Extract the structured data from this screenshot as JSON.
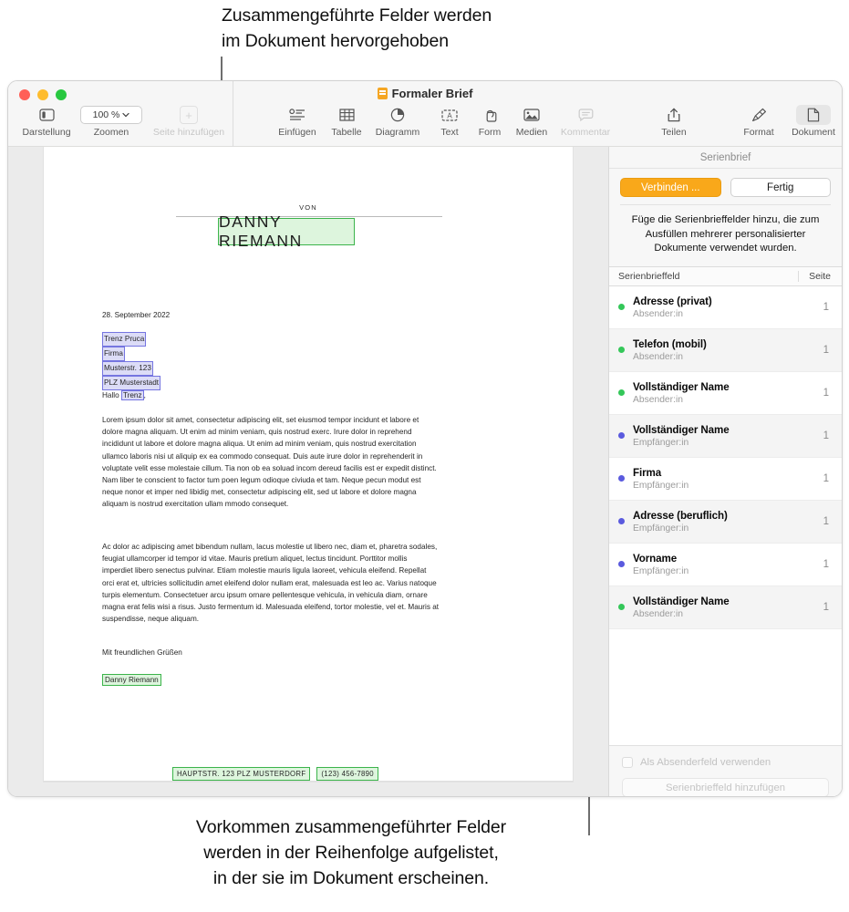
{
  "callouts": {
    "top": "Zusammengeführte Felder werden\nim Dokument hervorgehoben",
    "bottom": "Vorkommen zusammengeführter Felder\nwerden in der Reihenfolge aufgelistet,\nin der sie im Dokument erscheinen."
  },
  "window": {
    "title": "Formaler Brief"
  },
  "toolbar": {
    "view_label": "Darstellung",
    "zoom_label": "Zoomen",
    "zoom_value": "100 %",
    "add_page_label": "Seite hinzufügen",
    "insert_label": "Einfügen",
    "table_label": "Tabelle",
    "chart_label": "Diagramm",
    "text_label": "Text",
    "shape_label": "Form",
    "media_label": "Medien",
    "comment_label": "Kommentar",
    "share_label": "Teilen",
    "format_label": "Format",
    "document_label": "Dokument"
  },
  "document": {
    "letterhead_label": "VON",
    "letterhead_name": "DANNY RIEMANN",
    "date": "28. September 2022",
    "address": [
      "Trenz Pruca",
      "Firma",
      "Musterstr. 123",
      "PLZ Musterstadt"
    ],
    "salutation_prefix": "Hallo ",
    "salutation_field": "Trenz",
    "salutation_suffix": ",",
    "paragraph_1": "Lorem ipsum dolor sit amet, consectetur adipiscing elit, set eiusmod tempor incidunt et labore et dolore magna aliquam. Ut enim ad minim veniam, quis nostrud exerc. Irure dolor in reprehend incididunt ut labore et dolore magna aliqua. Ut enim ad minim veniam, quis nostrud exercitation ullamco laboris nisi ut aliquip ex ea commodo consequat. Duis aute irure dolor in reprehenderit in voluptate velit esse molestaie cillum. Tia non ob ea soluad incom dereud facilis est er expedit distinct. Nam liber te conscient to factor tum poen legum odioque civiuda et tam. Neque pecun modut est neque nonor et imper ned libidig met, consectetur adipiscing elit, sed ut labore et dolore magna aliquam is nostrud exercitation ullam mmodo consequet.",
    "paragraph_2": "Ac dolor ac adipiscing amet bibendum nullam, lacus molestie ut libero nec, diam et, pharetra sodales, feugiat ullamcorper id tempor id vitae. Mauris pretium aliquet, lectus tincidunt. Porttitor mollis imperdiet libero senectus pulvinar. Etiam molestie mauris ligula laoreet, vehicula eleifend. Repellat orci erat et, ultricies sollicitudin amet eleifend dolor nullam erat, malesuada est leo ac. Varius natoque turpis elementum. Consectetuer arcu ipsum ornare pellentesque vehicula, in vehicula diam, ornare magna erat felis wisi a risus. Justo fermentum id. Malesuada eleifend, tortor molestie, vel et. Mauris at suspendisse, neque aliquam.",
    "sign_off": "Mit freundlichen Grüßen",
    "signature_name": "Danny Riemann",
    "footer_address": "HAUPTSTR. 123     PLZ MUSTERDORF",
    "footer_phone": "(123) 456-7890"
  },
  "inspector": {
    "title": "Serienbrief",
    "merge_button": "Verbinden ...",
    "done_button": "Fertig",
    "description": "Füge die Serienbrieffelder hinzu, die zum Ausfüllen mehrerer personalisierter Dokumente verwendet wurden.",
    "column_field": "Serienbrieffeld",
    "column_page": "Seite",
    "sender_checkbox_label": "Als Absenderfeld verwenden",
    "add_field_button": "Serienbrieffeld hinzufügen",
    "colors": {
      "sender": "#34c759",
      "recipient": "#5a5ade",
      "accent": "#f9a81a"
    },
    "fields": [
      {
        "name": "Adresse (privat)",
        "role": "Absender:in",
        "page": "1",
        "color": "#34c759"
      },
      {
        "name": "Telefon (mobil)",
        "role": "Absender:in",
        "page": "1",
        "color": "#34c759"
      },
      {
        "name": "Vollständiger Name",
        "role": "Absender:in",
        "page": "1",
        "color": "#34c759"
      },
      {
        "name": "Vollständiger Name",
        "role": "Empfänger:in",
        "page": "1",
        "color": "#5a5ade"
      },
      {
        "name": "Firma",
        "role": "Empfänger:in",
        "page": "1",
        "color": "#5a5ade"
      },
      {
        "name": "Adresse (beruflich)",
        "role": "Empfänger:in",
        "page": "1",
        "color": "#5a5ade"
      },
      {
        "name": "Vorname",
        "role": "Empfänger:in",
        "page": "1",
        "color": "#5a5ade"
      },
      {
        "name": "Vollständiger Name",
        "role": "Absender:in",
        "page": "1",
        "color": "#34c759"
      }
    ]
  }
}
